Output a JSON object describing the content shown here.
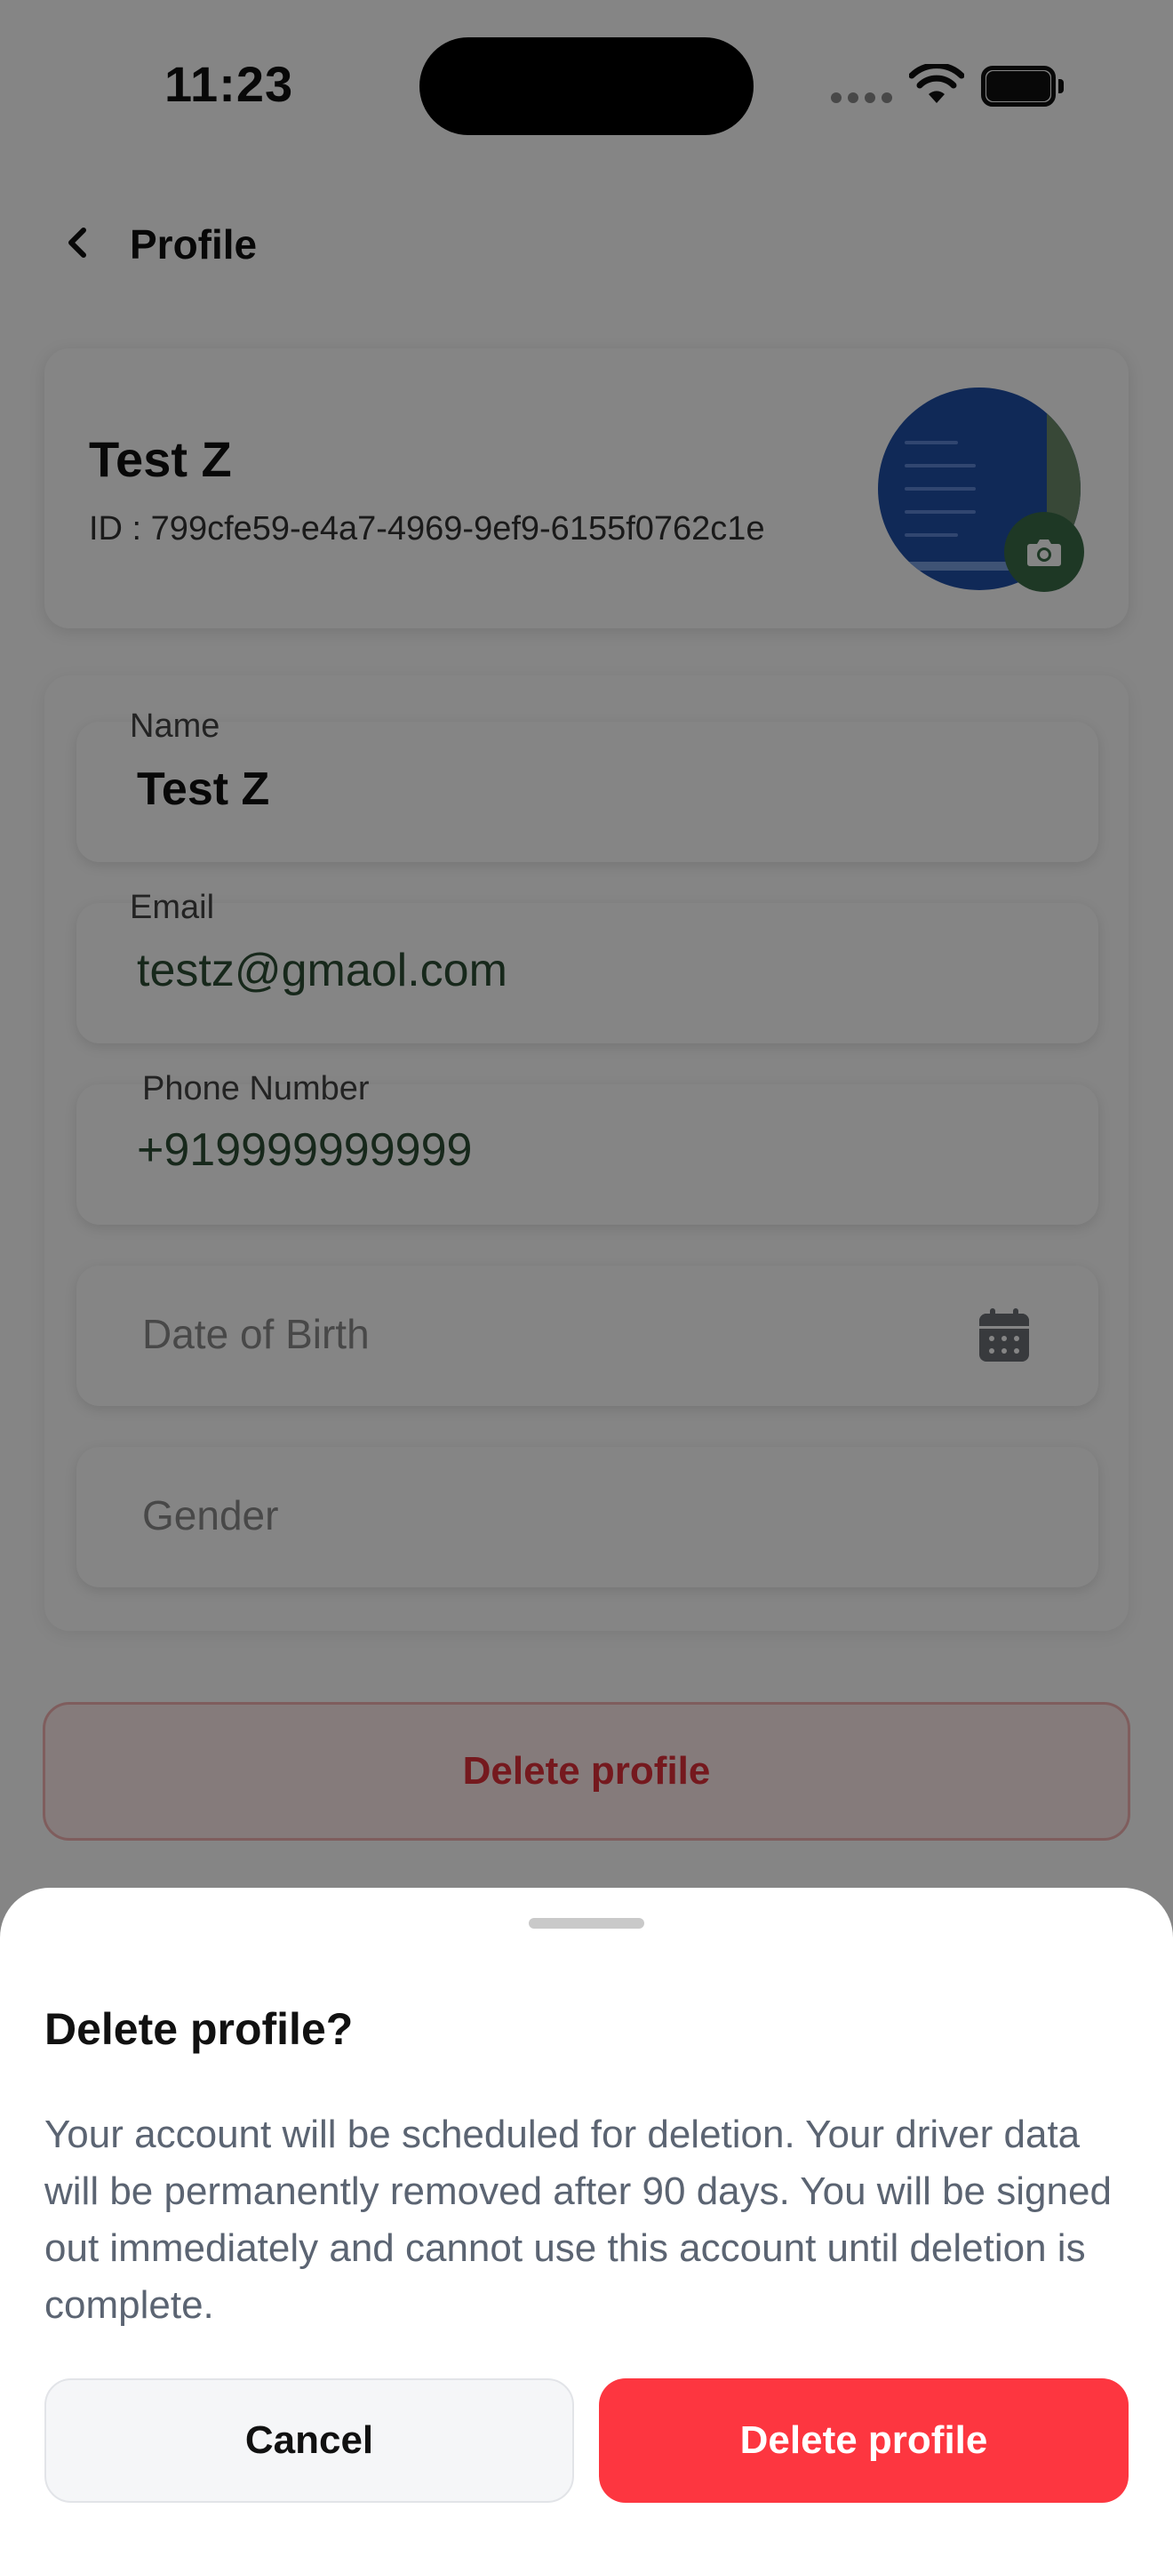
{
  "status_bar": {
    "time": "11:23"
  },
  "header": {
    "title": "Profile",
    "back_icon": "chevron-left-icon"
  },
  "profile": {
    "name": "Test Z",
    "id_text": "ID : 799cfe59-e4a7-4969-9ef9-6155f0762c1e",
    "camera_icon": "camera-icon"
  },
  "form": {
    "name_label": "Name",
    "name_value": "Test Z",
    "email_label": "Email",
    "email_value": "testz@gmaol.com",
    "phone_label": "Phone Number",
    "phone_value": "+919999999999",
    "dob_placeholder": "Date of Birth",
    "gender_placeholder": "Gender"
  },
  "page_delete_button": "Delete profile",
  "sheet": {
    "title": "Delete profile?",
    "message": "Your account will be scheduled for deletion. Your driver data will be permanently removed after 90 days. You will be signed out immediately and cannot use this account until deletion is complete.",
    "cancel_label": "Cancel",
    "delete_label": "Delete profile"
  },
  "colors": {
    "danger": "#fd3640",
    "muted_text": "#5b6472",
    "accent_green": "#3b6b48"
  }
}
